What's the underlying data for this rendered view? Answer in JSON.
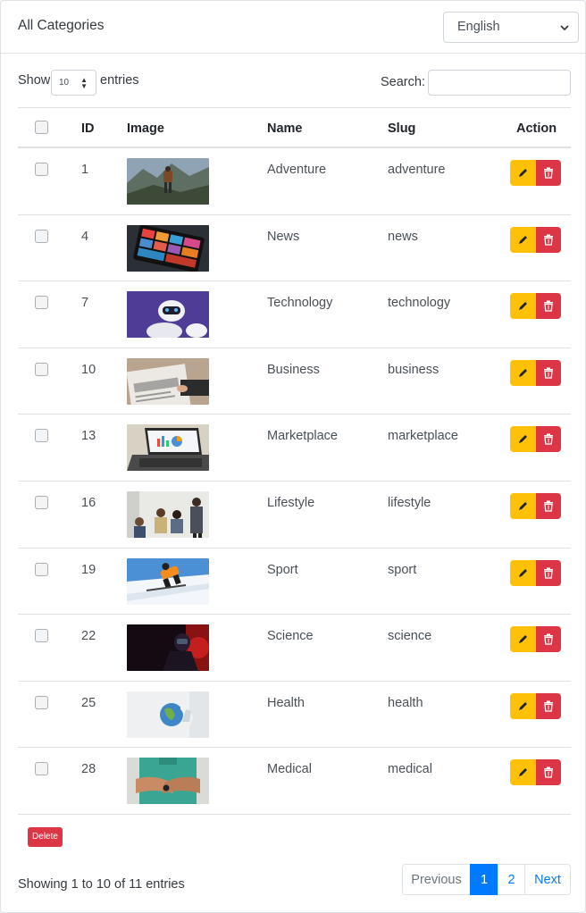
{
  "header": {
    "title": "All Categories",
    "language": "English"
  },
  "controls": {
    "show_label": "Show",
    "page_size": "10",
    "entries_label": "entries",
    "search_label": "Search:",
    "search_value": ""
  },
  "table": {
    "columns": {
      "id": "ID",
      "image": "Image",
      "name": "Name",
      "slug": "Slug",
      "action": "Action"
    },
    "rows": [
      {
        "id": "1",
        "name": "Adventure",
        "slug": "adventure",
        "image": "hiker-mountains"
      },
      {
        "id": "4",
        "name": "News",
        "slug": "news",
        "image": "tablet-news"
      },
      {
        "id": "7",
        "name": "Technology",
        "slug": "technology",
        "image": "robot"
      },
      {
        "id": "10",
        "name": "Business",
        "slug": "business",
        "image": "business-newspaper"
      },
      {
        "id": "13",
        "name": "Marketplace",
        "slug": "marketplace",
        "image": "laptop-charts"
      },
      {
        "id": "16",
        "name": "Lifestyle",
        "slug": "lifestyle",
        "image": "people-group"
      },
      {
        "id": "19",
        "name": "Sport",
        "slug": "sport",
        "image": "skier"
      },
      {
        "id": "22",
        "name": "Science",
        "slug": "science",
        "image": "lab-red-light"
      },
      {
        "id": "25",
        "name": "Health",
        "slug": "health",
        "image": "hand-globe"
      },
      {
        "id": "28",
        "name": "Medical",
        "slug": "medical",
        "image": "doctor-arms-crossed"
      }
    ]
  },
  "bulk": {
    "delete_label": "Delete"
  },
  "footer": {
    "info": "Showing 1 to 10 of 11 entries",
    "previous": "Previous",
    "page1": "1",
    "page2": "2",
    "next": "Next"
  },
  "colors": {
    "edit": "#ffc107",
    "delete": "#dc3545",
    "primary": "#007bff"
  }
}
